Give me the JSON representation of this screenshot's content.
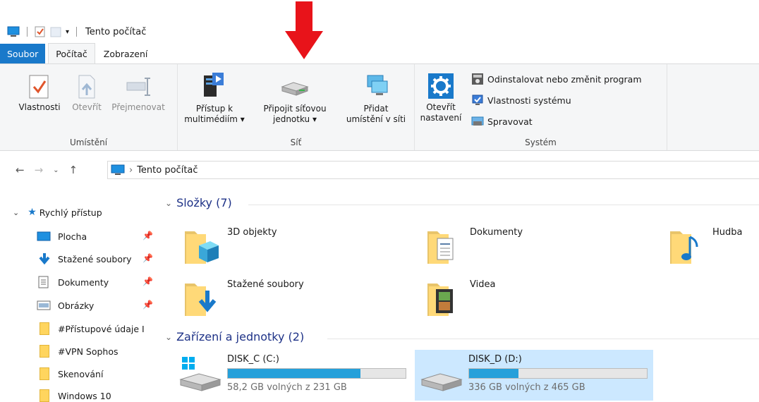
{
  "window": {
    "title": "Tento počítač"
  },
  "tabs": [
    {
      "label": "Soubor"
    },
    {
      "label": "Počítač"
    },
    {
      "label": "Zobrazení"
    }
  ],
  "ribbon": {
    "location": {
      "label": "Umístění",
      "buttons": [
        {
          "label": "Vlastnosti",
          "icon": "properties-checkmark-icon"
        },
        {
          "label": "Otevřít",
          "icon": "open-icon",
          "disabled": true
        },
        {
          "label": "Přejmenovat",
          "icon": "rename-icon",
          "disabled": true
        }
      ]
    },
    "network": {
      "label": "Síť",
      "buttons": [
        {
          "line1": "Přístup k",
          "line2": "multimédiím ▾",
          "icon": "media-server-icon"
        },
        {
          "line1": "Připojit síťovou",
          "line2": "jednotku ▾",
          "icon": "network-drive-icon"
        },
        {
          "line1": "Přidat",
          "line2": "umístění v síti",
          "icon": "network-location-icon"
        }
      ]
    },
    "system": {
      "label": "Systém",
      "open_settings": {
        "line1": "Otevřít",
        "line2": "nastavení",
        "icon": "settings-gear-icon"
      },
      "small": [
        {
          "label": "Odinstalovat nebo změnit program",
          "icon": "uninstall-icon"
        },
        {
          "label": "Vlastnosti systému",
          "icon": "system-properties-icon"
        },
        {
          "label": "Spravovat",
          "icon": "manage-icon"
        }
      ]
    }
  },
  "address": {
    "path": "Tento počítač"
  },
  "navpane": {
    "items": [
      {
        "label": "Rychlý přístup",
        "icon": "star-icon",
        "pinned": false
      },
      {
        "label": "Plocha",
        "icon": "desktop-icon",
        "pinned": true
      },
      {
        "label": "Stažené soubory",
        "icon": "download-arrow-icon",
        "pinned": true
      },
      {
        "label": "Dokumenty",
        "icon": "documents-icon",
        "pinned": true
      },
      {
        "label": "Obrázky",
        "icon": "pictures-icon",
        "pinned": true
      },
      {
        "label": "#Přístupové údaje I",
        "icon": "folder-icon",
        "pinned": false
      },
      {
        "label": "#VPN Sophos",
        "icon": "folder-icon",
        "pinned": false
      },
      {
        "label": "Skenování",
        "icon": "folder-icon",
        "pinned": false
      },
      {
        "label": "Windows 10",
        "icon": "folder-icon",
        "pinned": false
      }
    ]
  },
  "content": {
    "folders_header": "Složky (7)",
    "folders": [
      {
        "label": "3D objekty",
        "icon": "3d-objects-folder-icon"
      },
      {
        "label": "Dokumenty",
        "icon": "documents-folder-icon"
      },
      {
        "label": "Hudba",
        "icon": "music-folder-icon"
      },
      {
        "label": "Stažené soubory",
        "icon": "downloads-folder-icon"
      },
      {
        "label": "Videa",
        "icon": "videos-folder-icon"
      }
    ],
    "drives_header": "Zařízení a jednotky (2)",
    "drives": [
      {
        "name": "DISK_C (C:)",
        "free": "58,2 GB volných z 231 GB",
        "used_fraction": 0.748,
        "selected": false
      },
      {
        "name": "DISK_D (D:)",
        "free": "336 GB volných z 465 GB",
        "used_fraction": 0.277,
        "selected": true
      }
    ]
  },
  "colors": {
    "accent": "#1979ca",
    "bar_fill": "#26a0da",
    "selection": "#cce8ff",
    "annotation_arrow": "#e8131a"
  }
}
